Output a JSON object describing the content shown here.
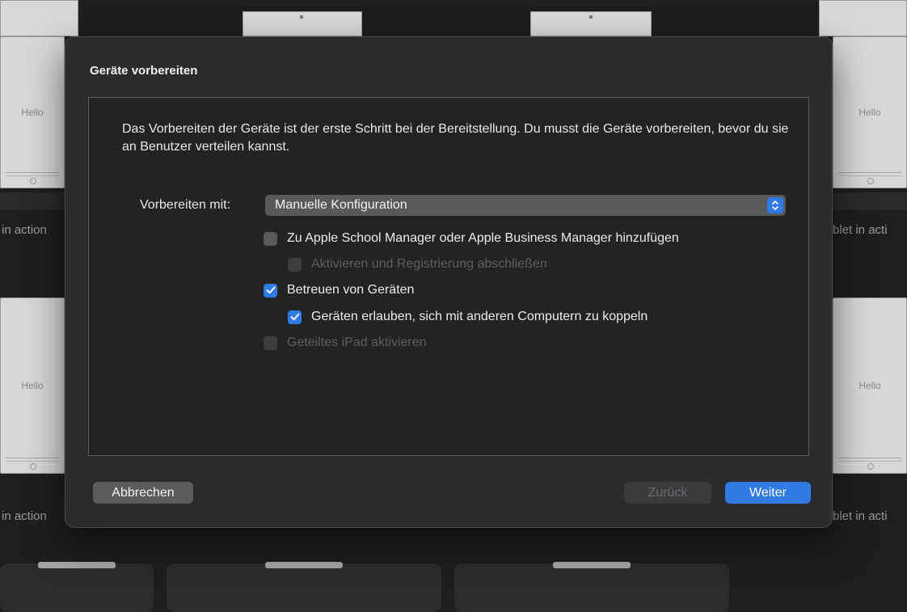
{
  "background": {
    "device_text": "Hello",
    "caption_left": "in action",
    "caption_right": "blet in acti"
  },
  "dialog": {
    "title": "Geräte vorbereiten",
    "intro": "Das Vorbereiten der Geräte ist der erste Schritt bei der Bereitstellung. Du musst die Geräte vorbereiten, bevor du sie an Benutzer verteilen kannst.",
    "prepare_with_label": "Vorbereiten mit:",
    "prepare_with_value": "Manuelle Konfiguration",
    "options": [
      {
        "label": "Zu Apple School Manager oder Apple Business Manager hinzufügen",
        "checked": false,
        "enabled": true
      },
      {
        "label": "Aktivieren und Registrierung abschließen",
        "checked": false,
        "enabled": false
      },
      {
        "label": "Betreuen von Geräten",
        "checked": true,
        "enabled": true
      },
      {
        "label": "Geräten erlauben, sich mit anderen Computern zu koppeln",
        "checked": true,
        "enabled": true
      },
      {
        "label": "Geteiltes iPad aktivieren",
        "checked": false,
        "enabled": false
      }
    ],
    "buttons": {
      "cancel": "Abbrechen",
      "back": "Zurück",
      "next": "Weiter"
    },
    "accent_color": "#2f7ae5"
  }
}
